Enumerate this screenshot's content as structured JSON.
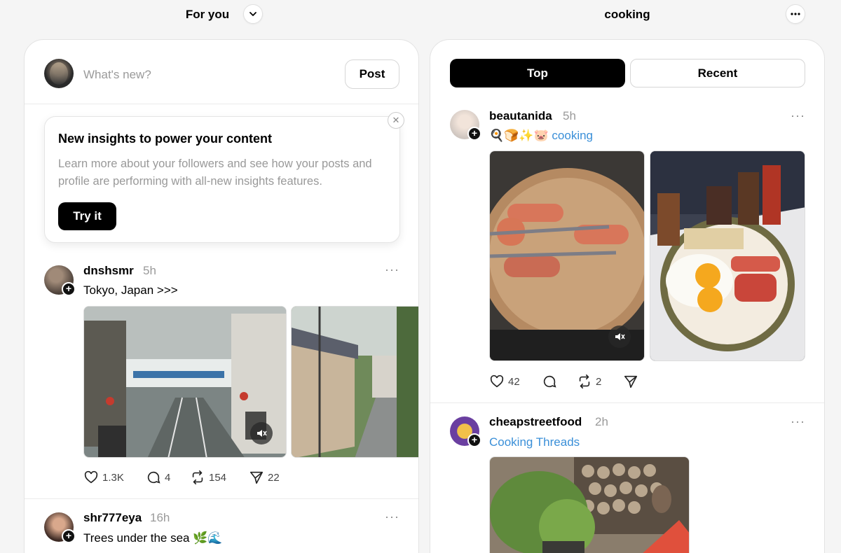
{
  "columns": {
    "left_title": "For you",
    "right_title": "cooking"
  },
  "composer": {
    "placeholder": "What's new?",
    "post_label": "Post"
  },
  "insight": {
    "title": "New insights to power your content",
    "body": "Learn more about your followers and see how your posts and profile are performing with all-new insights features.",
    "button": "Try it"
  },
  "left_posts": [
    {
      "username": "dnshsmr",
      "time": "5h",
      "caption": "Tokyo, Japan >>>",
      "likes": "1.3K",
      "comments": "4",
      "reposts": "154",
      "shares": "22"
    },
    {
      "username": "shr777eya",
      "time": "16h",
      "caption": "Trees under the sea 🌿🌊"
    }
  ],
  "tabs": {
    "top": "Top",
    "recent": "Recent"
  },
  "right_posts": [
    {
      "username": "beautanida",
      "time": "5h",
      "emoji": "🍳🍞✨🐷",
      "topic": "cooking",
      "likes": "42",
      "reposts": "2"
    },
    {
      "username": "cheapstreetfood",
      "time": "2h",
      "topic": "Cooking Threads"
    }
  ],
  "icons": {
    "chevron": "chevron-down-icon",
    "more": "more-horizontal-icon",
    "like": "heart-icon",
    "comment": "comment-icon",
    "repost": "repost-icon",
    "share": "send-icon",
    "mute": "speaker-muted-icon"
  }
}
